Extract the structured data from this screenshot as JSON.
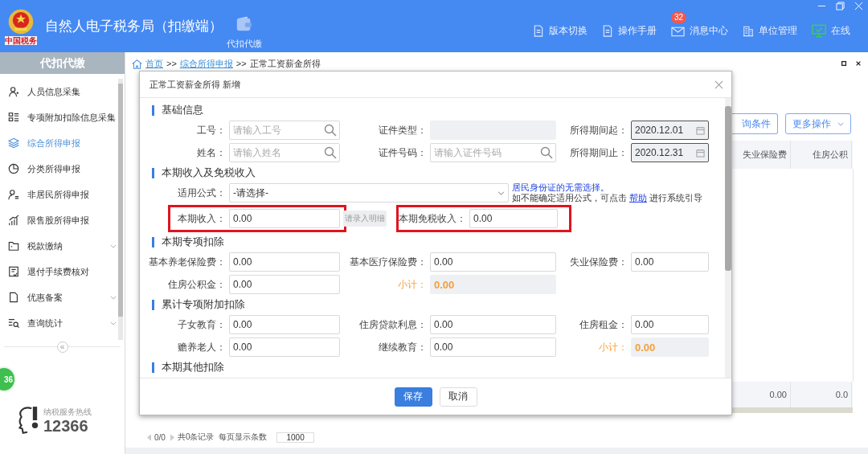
{
  "header": {
    "emblem_text": "中国税务",
    "title": "自然人电子税务局（扣缴端）",
    "nav": [
      {
        "label": "代扣代缴"
      }
    ],
    "links": [
      {
        "kind": "doc",
        "label": "版本切换"
      },
      {
        "kind": "doc",
        "label": "操作手册"
      },
      {
        "kind": "mail",
        "label": "消息中心",
        "badge": "32"
      },
      {
        "kind": "building",
        "label": "单位管理"
      },
      {
        "kind": "online",
        "label": "在线"
      }
    ]
  },
  "sidebar": {
    "title": "代扣代缴",
    "items": [
      {
        "label": "人员信息采集",
        "selected": false,
        "submenu": false
      },
      {
        "label": "专项附加扣除信息采集",
        "selected": false,
        "submenu": false
      },
      {
        "label": "综合所得申报",
        "selected": true,
        "submenu": false
      },
      {
        "label": "分类所得申报",
        "selected": false,
        "submenu": false
      },
      {
        "label": "非居民所得申报",
        "selected": false,
        "submenu": false
      },
      {
        "label": "限售股所得申报",
        "selected": false,
        "submenu": false
      },
      {
        "label": "税款缴纳",
        "selected": false,
        "submenu": true
      },
      {
        "label": "退付手续费核对",
        "selected": false,
        "submenu": false
      },
      {
        "label": "优惠备案",
        "selected": false,
        "submenu": true
      },
      {
        "label": "查询统计",
        "selected": false,
        "submenu": true
      }
    ],
    "collapse": "«",
    "float_badge": "36",
    "hotline": {
      "label": "纳税服务热线",
      "number": "12366"
    }
  },
  "breadcrumb": [
    {
      "kind": "link",
      "label": "首页"
    },
    {
      "kind": "sep",
      "label": ">>"
    },
    {
      "kind": "link",
      "label": "综合所得申报"
    },
    {
      "kind": "sep",
      "label": ">>"
    },
    {
      "kind": "current",
      "label": "正常工资薪金所得"
    }
  ],
  "toolbar": [
    {
      "label": "询条件",
      "dropdown": false
    },
    {
      "label": "更多操作",
      "dropdown": true
    }
  ],
  "table": {
    "columns": [
      "失业保险费",
      "住房公积"
    ],
    "totals": [
      "0.00",
      "0.0"
    ]
  },
  "pagination": {
    "page": "0/0",
    "records": "共0条记录",
    "size_label": "每页显示条数",
    "size": "1000"
  },
  "dialog": {
    "title": "正常工资薪金所得 新增",
    "sections": [
      {
        "kind": "grid",
        "title": "基础信息",
        "rows": [
          [
            {
              "kind": "search",
              "label": "工号：",
              "placeholder": "请输入工号"
            },
            {
              "kind": "disabled",
              "label": "证件类型："
            },
            {
              "kind": "date",
              "label": "所得期间起：",
              "value": "2020.12.01"
            }
          ],
          [
            {
              "kind": "search",
              "label": "姓名：",
              "placeholder": "请输入姓名"
            },
            {
              "kind": "search",
              "label": "证件号码：",
              "placeholder": "请输入证件号码"
            },
            {
              "kind": "date",
              "label": "所得期间止：",
              "value": "2020.12.31"
            }
          ]
        ]
      },
      {
        "kind": "income",
        "title": "本期收入及免税收入",
        "formula": {
          "label": "适用公式：",
          "value": "-请选择-",
          "note": "居民身份证的无需选择。",
          "hint_before": "如不能确定适用公式，可点击 ",
          "hint_link": "帮助",
          "hint_after": " 进行系统引导"
        },
        "income": [
          {
            "label": "本期收入：",
            "value": "0.00",
            "highlighted": true,
            "button": {
              "label": "请录入明细",
              "disabled": true
            }
          },
          {
            "label": "本期免税收入：",
            "value": "0.00",
            "highlighted": true
          }
        ]
      },
      {
        "kind": "grid",
        "title": "本期专项扣除",
        "rows": [
          [
            {
              "kind": "input",
              "label": "基本养老保险费：",
              "value": "0.00"
            },
            {
              "kind": "input",
              "label": "基本医疗保险费：",
              "value": "0.00"
            },
            {
              "kind": "input",
              "label": "失业保险费：",
              "value": "0.00"
            }
          ],
          [
            {
              "kind": "input",
              "label": "住房公积金：",
              "value": "0.00"
            },
            {
              "kind": "subtotal",
              "label": "小计：",
              "value": "0.00"
            }
          ]
        ]
      },
      {
        "kind": "grid",
        "title": "累计专项附加扣除",
        "rows": [
          [
            {
              "kind": "input",
              "label": "子女教育：",
              "value": "0.00"
            },
            {
              "kind": "input",
              "label": "住房贷款利息：",
              "value": "0.00"
            },
            {
              "kind": "input",
              "label": "住房租金：",
              "value": "0.00"
            }
          ],
          [
            {
              "kind": "input",
              "label": "赡养老人：",
              "value": "0.00"
            },
            {
              "kind": "input",
              "label": "继续教育：",
              "value": "0.00"
            },
            {
              "kind": "subtotal",
              "label": "小计：",
              "value": "0.00"
            }
          ]
        ]
      },
      {
        "kind": "grid",
        "title": "本期其他扣除"
      }
    ],
    "buttons": [
      {
        "kind": "primary",
        "label": "保存"
      },
      {
        "kind": "default",
        "label": "取消"
      }
    ]
  }
}
